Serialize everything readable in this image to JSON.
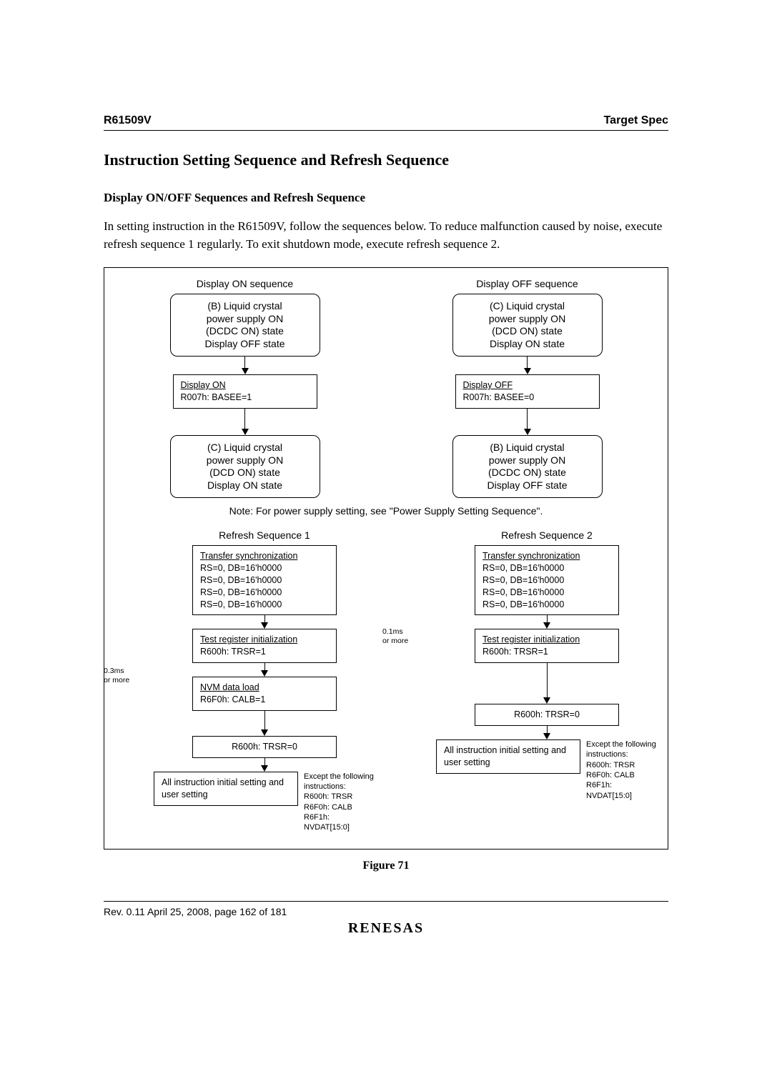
{
  "header": {
    "left": "R61509V",
    "right": "Target Spec"
  },
  "section_title": "Instruction Setting Sequence and Refresh Sequence",
  "sub_title": "Display ON/OFF Sequences and Refresh Sequence",
  "body_text": "In setting instruction in the R61509V, follow the sequences below. To reduce malfunction caused by noise, execute refresh sequence 1 regularly. To exit shutdown mode, execute refresh sequence 2.",
  "fig": {
    "on_title": "Display ON sequence",
    "off_title": "Display OFF sequence",
    "box_on_b": "(B) Liquid crystal\npower supply ON\n(DCDC ON) state\nDisplay OFF state",
    "box_off_c_top": "(C) Liquid crystal\npower supply ON\n(DCD ON) state\nDisplay ON state",
    "disp_on_label": "Display ON",
    "disp_on_reg": "R007h: BASEE=1",
    "disp_off_label": "Display OFF",
    "disp_off_reg": "R007h: BASEE=0",
    "box_on_c": "(C) Liquid crystal\npower supply ON\n(DCD ON) state\nDisplay ON state",
    "box_off_b": "(B) Liquid crystal\npower supply ON\n(DCDC ON) state\nDisplay OFF state",
    "note": "Note: For power supply setting, see \"Power Supply Setting Sequence\".",
    "rs1_title": "Refresh Sequence 1",
    "rs2_title": "Refresh Sequence 2",
    "tsync_label": "Transfer synchronization",
    "tsync_lines": "RS=0, DB=16'h0000\nRS=0, DB=16'h0000\nRS=0, DB=16'h0000\nRS=0, DB=16'h0000",
    "treg_label": "Test register initialization",
    "treg_reg": "R600h: TRSR=1",
    "nvm_label": "NVM data load",
    "nvm_reg": "R6F0h: CALB=1",
    "trsr0": "R600h: TRSR=0",
    "allinst": "All instruction initial setting and user setting",
    "except_label": "Except the following instructions:",
    "except_lines": "R600h: TRSR\nR6F0h: CALB\nR6F1h: NVDAT[15:0]",
    "wait_03": "0.3ms\nor more",
    "wait_01": "0.1ms\nor more",
    "caption": "Figure 71"
  },
  "footer": {
    "rev": "Rev. 0.11 April 25, 2008, page 162 of 181",
    "brand": "RENESAS"
  }
}
